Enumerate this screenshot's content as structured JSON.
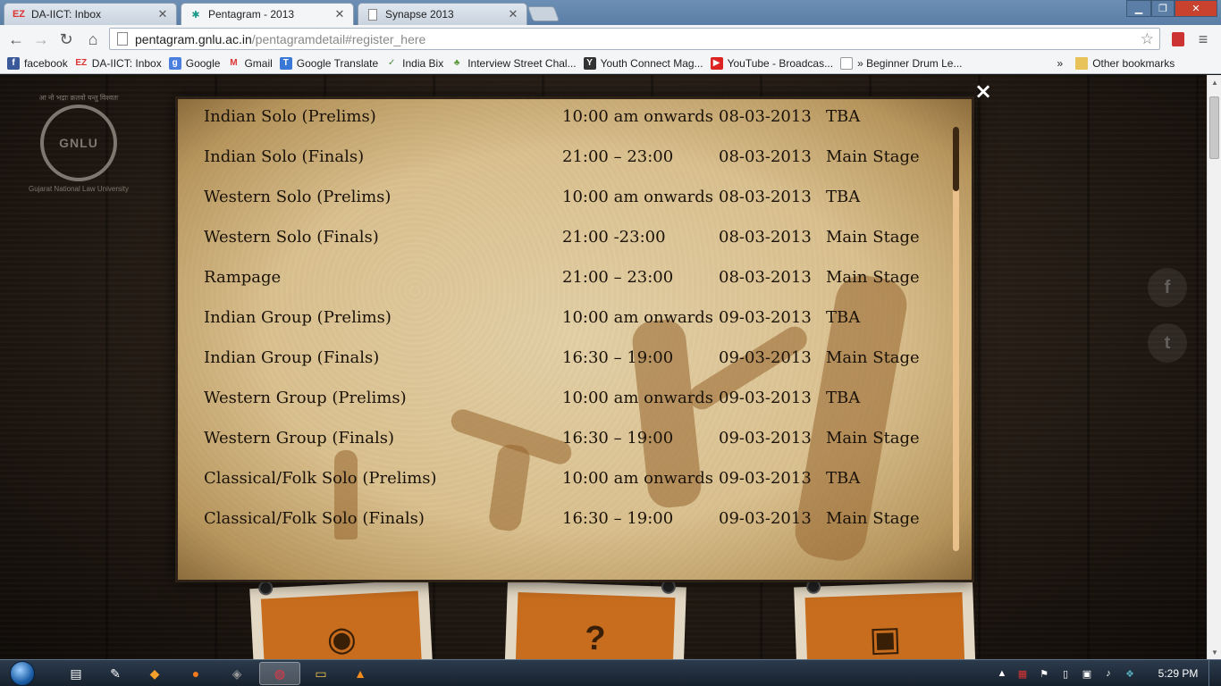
{
  "browser": {
    "tabs": [
      {
        "title": "DA-IICT: Inbox",
        "favicon": "EZ",
        "active": false
      },
      {
        "title": "Pentagram - 2013",
        "favicon": "star",
        "active": true
      },
      {
        "title": "Synapse 2013",
        "favicon": "page",
        "active": false
      }
    ],
    "url_host": "pentagram.gnlu.ac.in",
    "url_path": "/pentagramdetail#register_here",
    "bookmarks": [
      {
        "label": "facebook",
        "icon": "f",
        "color": "#3b5998"
      },
      {
        "label": "DA-IICT: Inbox",
        "icon": "EZ",
        "color": "#d33"
      },
      {
        "label": "Google",
        "icon": "g",
        "color": "#4a7fe0"
      },
      {
        "label": "Gmail",
        "icon": "M",
        "color": "#d33"
      },
      {
        "label": "Google Translate",
        "icon": "T",
        "color": "#3a78d8"
      },
      {
        "label": "India Bix",
        "icon": "✓",
        "color": "#4a8a3a"
      },
      {
        "label": "Interview Street Chal...",
        "icon": "♣",
        "color": "#5a9a3a"
      },
      {
        "label": "Youth Connect Mag...",
        "icon": "Y",
        "color": "#333"
      },
      {
        "label": "YouTube - Broadcas...",
        "icon": "▶",
        "color": "#d22"
      },
      {
        "label": "» Beginner Drum Le...",
        "icon": "",
        "color": "#bbb"
      }
    ],
    "overflow_label": "»",
    "other_bookmarks": "Other bookmarks"
  },
  "page": {
    "logo_motto": "आ नो भद्राः क्रतवो यन्तु विश्वतः",
    "logo_text": "GNLU",
    "logo_caption": "Gujarat National Law University",
    "close_label": "×",
    "schedule": [
      {
        "event": "Indian Solo (Prelims)",
        "time": "10:00 am onwards",
        "date": "08-03-2013",
        "venue": "TBA"
      },
      {
        "event": "Indian Solo (Finals)",
        "time": "21:00 – 23:00",
        "date": "08-03-2013",
        "venue": "Main Stage"
      },
      {
        "event": "Western Solo (Prelims)",
        "time": "10:00 am onwards",
        "date": "08-03-2013",
        "venue": "TBA"
      },
      {
        "event": "Western Solo (Finals)",
        "time": "21:00 -23:00",
        "date": "08-03-2013",
        "venue": "Main Stage"
      },
      {
        "event": "Rampage",
        "time": "21:00 – 23:00",
        "date": "08-03-2013",
        "venue": "Main Stage"
      },
      {
        "event": "Indian Group (Prelims)",
        "time": "10:00 am onwards",
        "date": "09-03-2013",
        "venue": "TBA"
      },
      {
        "event": "Indian Group (Finals)",
        "time": "16:30 – 19:00",
        "date": "09-03-2013",
        "venue": "Main Stage"
      },
      {
        "event": "Western Group (Prelims)",
        "time": "10:00 am onwards",
        "date": "09-03-2013",
        "venue": "TBA"
      },
      {
        "event": "Western Group (Finals)",
        "time": "16:30 – 19:00",
        "date": "09-03-2013",
        "venue": "Main Stage"
      },
      {
        "event": "Classical/Folk Solo (Prelims)",
        "time": "10:00 am onwards",
        "date": "09-03-2013",
        "venue": "TBA"
      },
      {
        "event": "Classical/Folk Solo (Finals)",
        "time": "16:30 – 19:00",
        "date": "09-03-2013",
        "venue": "Main Stage"
      }
    ],
    "social": [
      {
        "icon": "f"
      },
      {
        "icon": "t"
      }
    ],
    "polaroid_icons": [
      "film-reel-icon",
      "question-icon",
      "camera-icon"
    ]
  },
  "taskbar": {
    "clock": "5:29 PM"
  }
}
